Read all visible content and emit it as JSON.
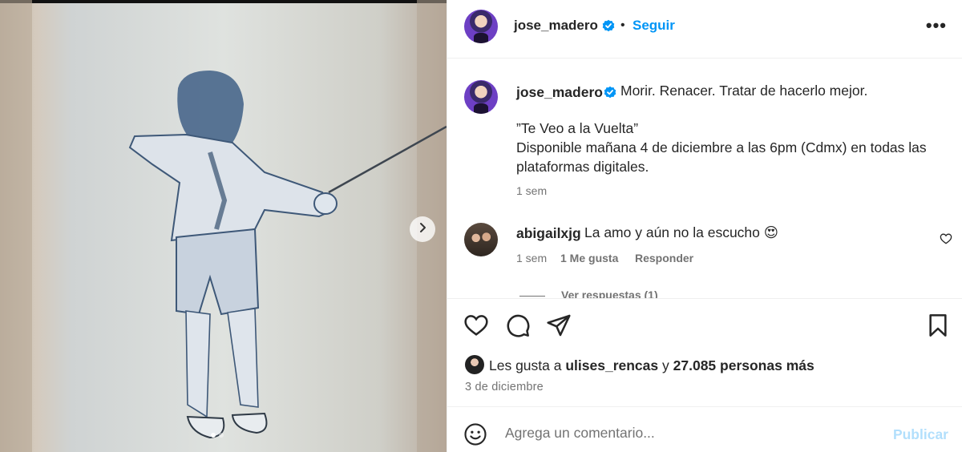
{
  "post": {
    "author": "jose_madero",
    "follow_separator": "•",
    "follow_label": "Seguir",
    "more_label": "•••",
    "verified_icon": "verified-badge-icon",
    "accent_color": "#0095f6"
  },
  "caption": {
    "username": "jose_madero",
    "lines": [
      "Morir. Renacer. Tratar de hacerlo mejor.",
      "",
      "”Te Veo a la Vuelta”",
      "Disponible mañana 4 de diciembre a las 6pm (Cdmx) en todas las",
      "plataformas digitales."
    ],
    "time": "1 sem"
  },
  "comments": [
    {
      "username": "abigailxjg",
      "text": "La amo y aún no la escucho 😍",
      "time": "1 sem",
      "likes": "1 Me gusta",
      "reply_label": "Responder",
      "view_replies": "Ver respuestas (1)"
    }
  ],
  "likes_line": {
    "prefix": "Les gusta a",
    "user": "ulises_rencas",
    "joiner": "y",
    "others": "27.085 personas más"
  },
  "date": "3 de diciembre",
  "composer": {
    "placeholder": "Agrega un comentario...",
    "publish_label": "Publicar"
  },
  "carousel": {
    "slide_count": 2,
    "active_index": 0
  }
}
